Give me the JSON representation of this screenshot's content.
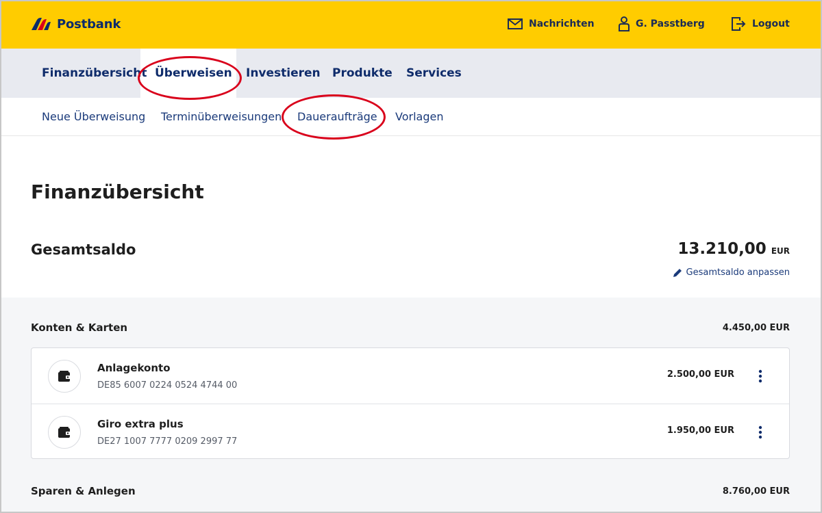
{
  "brand": {
    "name": "Postbank",
    "color": "#ffcc00",
    "navy": "#0f2c6b"
  },
  "topbar": {
    "messages": {
      "label": "Nachrichten",
      "icon": "envelope-icon"
    },
    "user": {
      "label": "G. Passtberg",
      "icon": "user-icon"
    },
    "logout": {
      "label": "Logout",
      "icon": "logout-icon"
    }
  },
  "mainnav": {
    "items": [
      {
        "label": "Finanzübersicht"
      },
      {
        "label": "Überweisen",
        "active": true
      },
      {
        "label": "Investieren"
      },
      {
        "label": "Produkte"
      },
      {
        "label": "Services"
      }
    ]
  },
  "subnav": {
    "items": [
      {
        "label": "Neue Überweisung"
      },
      {
        "label": "Terminüberweisungen"
      },
      {
        "label": "Daueraufträge"
      },
      {
        "label": "Vorlagen"
      }
    ]
  },
  "annotation_color": "#d9001b",
  "page": {
    "title": "Finanzübersicht",
    "saldo_label": "Gesamtsaldo",
    "saldo_amount": "13.210,00",
    "saldo_currency": "EUR",
    "saldo_edit_label": "Gesamtsaldo anpassen"
  },
  "groups": {
    "konten": {
      "label": "Konten & Karten",
      "amount": "4.450,00 EUR",
      "accounts": [
        {
          "name": "Anlagekonto",
          "iban": "DE85 6007 0224 0524 4744 00",
          "amount": "2.500,00",
          "currency": "EUR",
          "icon": "wallet-icon"
        },
        {
          "name": "Giro extra plus",
          "iban": "DE27 1007 7777 0209 2997 77",
          "amount": "1.950,00",
          "currency": "EUR",
          "icon": "wallet-icon"
        }
      ]
    },
    "sparen": {
      "label": "Sparen & Anlegen",
      "amount": "8.760,00 EUR"
    }
  }
}
